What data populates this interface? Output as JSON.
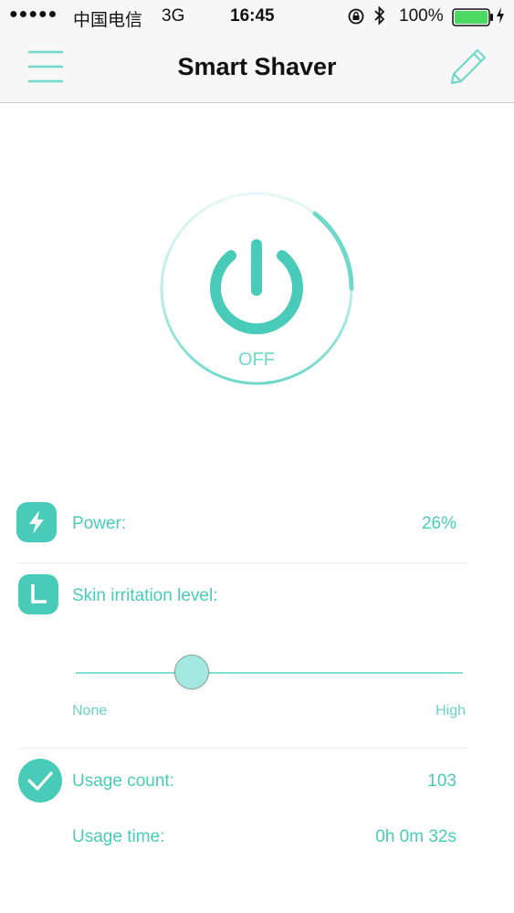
{
  "status_bar": {
    "signal": "●●●●●",
    "carrier": "中国电信",
    "network": "3G",
    "time": "16:45",
    "battery_percent": "100%",
    "icons": [
      "orientation-lock-icon",
      "bluetooth-icon",
      "battery-icon",
      "charging-icon"
    ]
  },
  "nav": {
    "title": "Smart Shaver",
    "left_icon": "menu-icon",
    "right_icon": "pencil-icon"
  },
  "power": {
    "state": "OFF",
    "icon": "power-icon"
  },
  "stats": {
    "power_label": "Power:",
    "power_value": "26%",
    "power_icon": "lightning-icon",
    "irritation_label": "Skin irritation level:",
    "irritation_icon": "l-shape-icon",
    "slider_min_label": "None",
    "slider_max_label": "High",
    "slider_level": 0.3,
    "usage_count_label": "Usage count:",
    "usage_count_value": "103",
    "usage_count_icon": "checkmark-icon",
    "usage_time_label": "Usage time:",
    "usage_time_value": "0h 0m 32s"
  },
  "colors": {
    "accent": "#48ccb9",
    "accent_light": "#7fe1d3",
    "nav_background": "#f7f7f7"
  }
}
